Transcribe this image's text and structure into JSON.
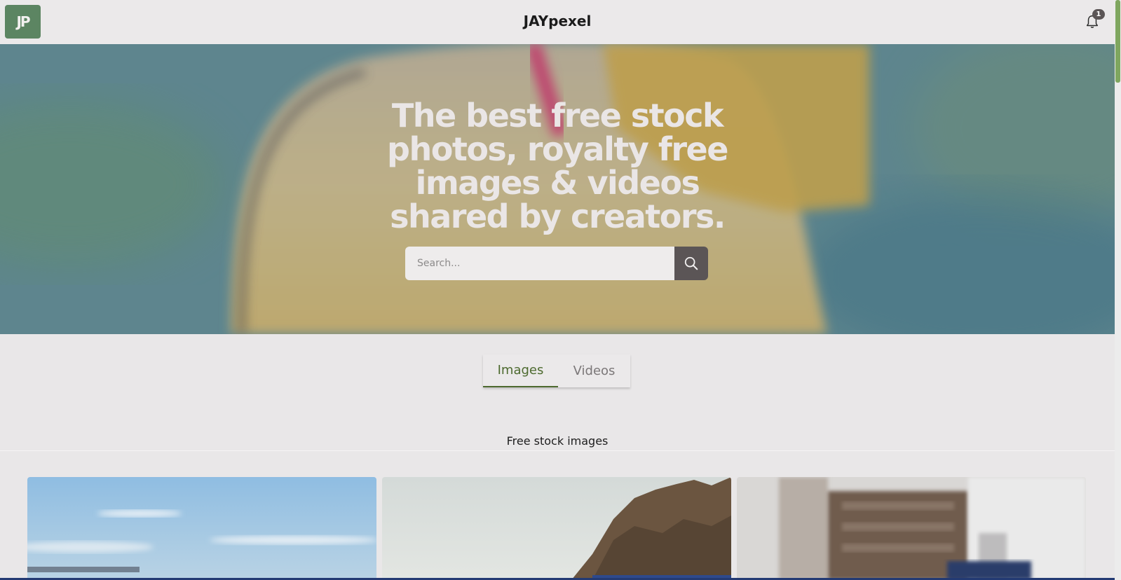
{
  "header": {
    "logo_text": "JP",
    "app_title": "JAYpexel",
    "notification_count": "1",
    "bell_icon": "bell-icon"
  },
  "hero": {
    "title": "The best free stock photos, royalty free images & videos shared by creators.",
    "search_placeholder": "Search...",
    "search_icon": "search-icon"
  },
  "tabs": [
    {
      "label": "Images",
      "active": true
    },
    {
      "label": "Videos",
      "active": false
    }
  ],
  "section": {
    "title": "Free stock images"
  },
  "colors": {
    "brand": "#5c8562",
    "active_tab": "#4d6a2f",
    "search_button": "#5b5556",
    "background": "#e9e7e8"
  }
}
